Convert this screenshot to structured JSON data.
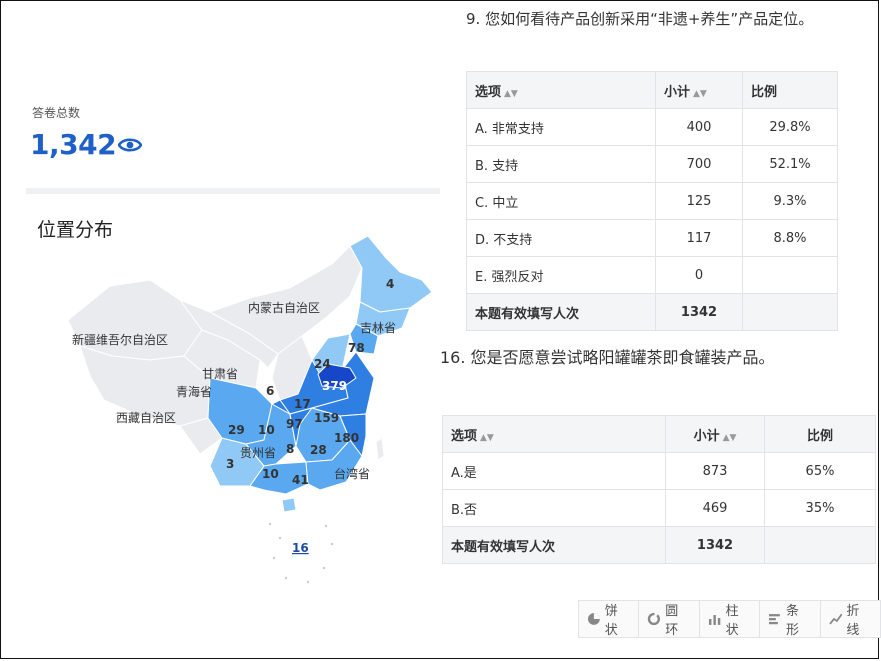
{
  "summary": {
    "label": "答卷总数",
    "value": "1,342"
  },
  "map": {
    "title": "位置分布",
    "region_labels": {
      "nei_menggu": "内蒙古自治区",
      "xinjiang": "新疆维吾尔自治区",
      "jilin": "吉林省",
      "gansu": "甘肃省",
      "qinghai": "青海省",
      "xizang": "西藏自治区",
      "guizhou": "贵州省",
      "taiwan": "台湾省"
    },
    "counts": {
      "heilongjiang": "4",
      "liaoning": "78",
      "beijing": "24",
      "shandong": "379",
      "ningxia": "6",
      "henan": "17",
      "jiangsu": "159",
      "hubei": "97",
      "zhejiang": "180",
      "sichuan": "29",
      "chongqing": "10",
      "hunan": "8",
      "jiangxi": "28",
      "yunnan": "3",
      "guangxi": "10",
      "guangdong": "41",
      "hainan": "16"
    },
    "colors": {
      "light": "#e9ebef",
      "pale_blue": "#90c8f6",
      "mid_blue": "#5aa8ef",
      "deep_blue": "#2f7fe2",
      "darkest": "#1747c9"
    }
  },
  "q9": {
    "title": "9. 您如何看待产品创新采用“非遗+养生”产品定位。",
    "headers": {
      "option": "选项",
      "subtotal": "小计",
      "ratio": "比例"
    },
    "rows": [
      {
        "option": "A. 非常支持",
        "count": "400",
        "ratio": "29.8%"
      },
      {
        "option": "B. 支持",
        "count": "700",
        "ratio": "52.1%"
      },
      {
        "option": "C. 中立",
        "count": "125",
        "ratio": "9.3%"
      },
      {
        "option": "D. 不支持",
        "count": "117",
        "ratio": "8.8%"
      },
      {
        "option": "E. 强烈反对",
        "count": "0",
        "ratio": ""
      }
    ],
    "total": {
      "label": "本题有效填写人次",
      "count": "1342"
    }
  },
  "q16": {
    "title": "16. 您是否愿意尝试略阳罐罐茶即食罐装产品。",
    "headers": {
      "option": "选项",
      "subtotal": "小计",
      "ratio": "比例"
    },
    "rows": [
      {
        "option": "A.是",
        "count": "873",
        "ratio": "65%"
      },
      {
        "option": "B.否",
        "count": "469",
        "ratio": "35%"
      }
    ],
    "total": {
      "label": "本题有效填写人次",
      "count": "1342"
    }
  },
  "chart_buttons": [
    {
      "icon": "pie-chart-icon",
      "label": "饼状"
    },
    {
      "icon": "donut-chart-icon",
      "label": "圆环"
    },
    {
      "icon": "bar-chart-icon",
      "label": "柱状"
    },
    {
      "icon": "horizontal-bar-icon",
      "label": "条形"
    },
    {
      "icon": "line-chart-icon",
      "label": "折线"
    }
  ]
}
